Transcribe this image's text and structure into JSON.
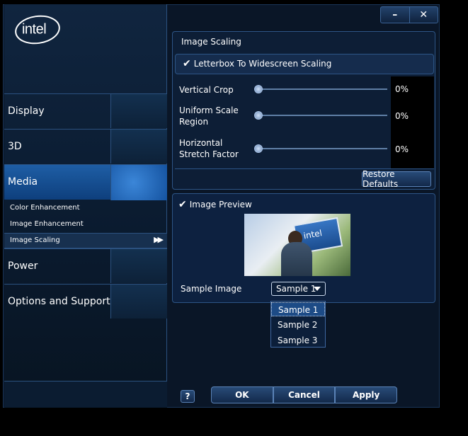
{
  "app": {
    "logo_text": "intel"
  },
  "window_controls": {
    "minimize": "–",
    "close": "✕"
  },
  "sidebar": {
    "items": [
      {
        "label": "Display"
      },
      {
        "label": "3D"
      },
      {
        "label": "Media"
      },
      {
        "label": "Power"
      },
      {
        "label": "Options and Support"
      }
    ],
    "media_subitems": [
      {
        "label": "Color Enhancement"
      },
      {
        "label": "Image Enhancement"
      },
      {
        "label": "Image Scaling"
      }
    ],
    "active_item": "Media",
    "selected_subitem": "Image Scaling"
  },
  "image_scaling": {
    "title": "Image Scaling",
    "letterbox_label": "Letterbox To Widescreen Scaling",
    "letterbox_checked": true,
    "sliders": [
      {
        "label": "Vertical Crop",
        "value": "0%"
      },
      {
        "label": "Uniform Scale Region",
        "value": "0%"
      },
      {
        "label": "Horizontal Stretch Factor",
        "value": "0%"
      }
    ],
    "restore_defaults": "Restore Defaults"
  },
  "preview": {
    "checkbox_label": "Image Preview",
    "checked": true,
    "image_sign_text": "intel",
    "sample_label": "Sample Image",
    "selected_sample": "Sample 1",
    "sample_options": [
      "Sample 1",
      "Sample 2",
      "Sample 3"
    ]
  },
  "footer": {
    "help": "?",
    "ok": "OK",
    "cancel": "Cancel",
    "apply": "Apply"
  },
  "colors": {
    "accent": "#1e5ea5",
    "panel_border": "#2d5586",
    "background": "#0a1627"
  }
}
